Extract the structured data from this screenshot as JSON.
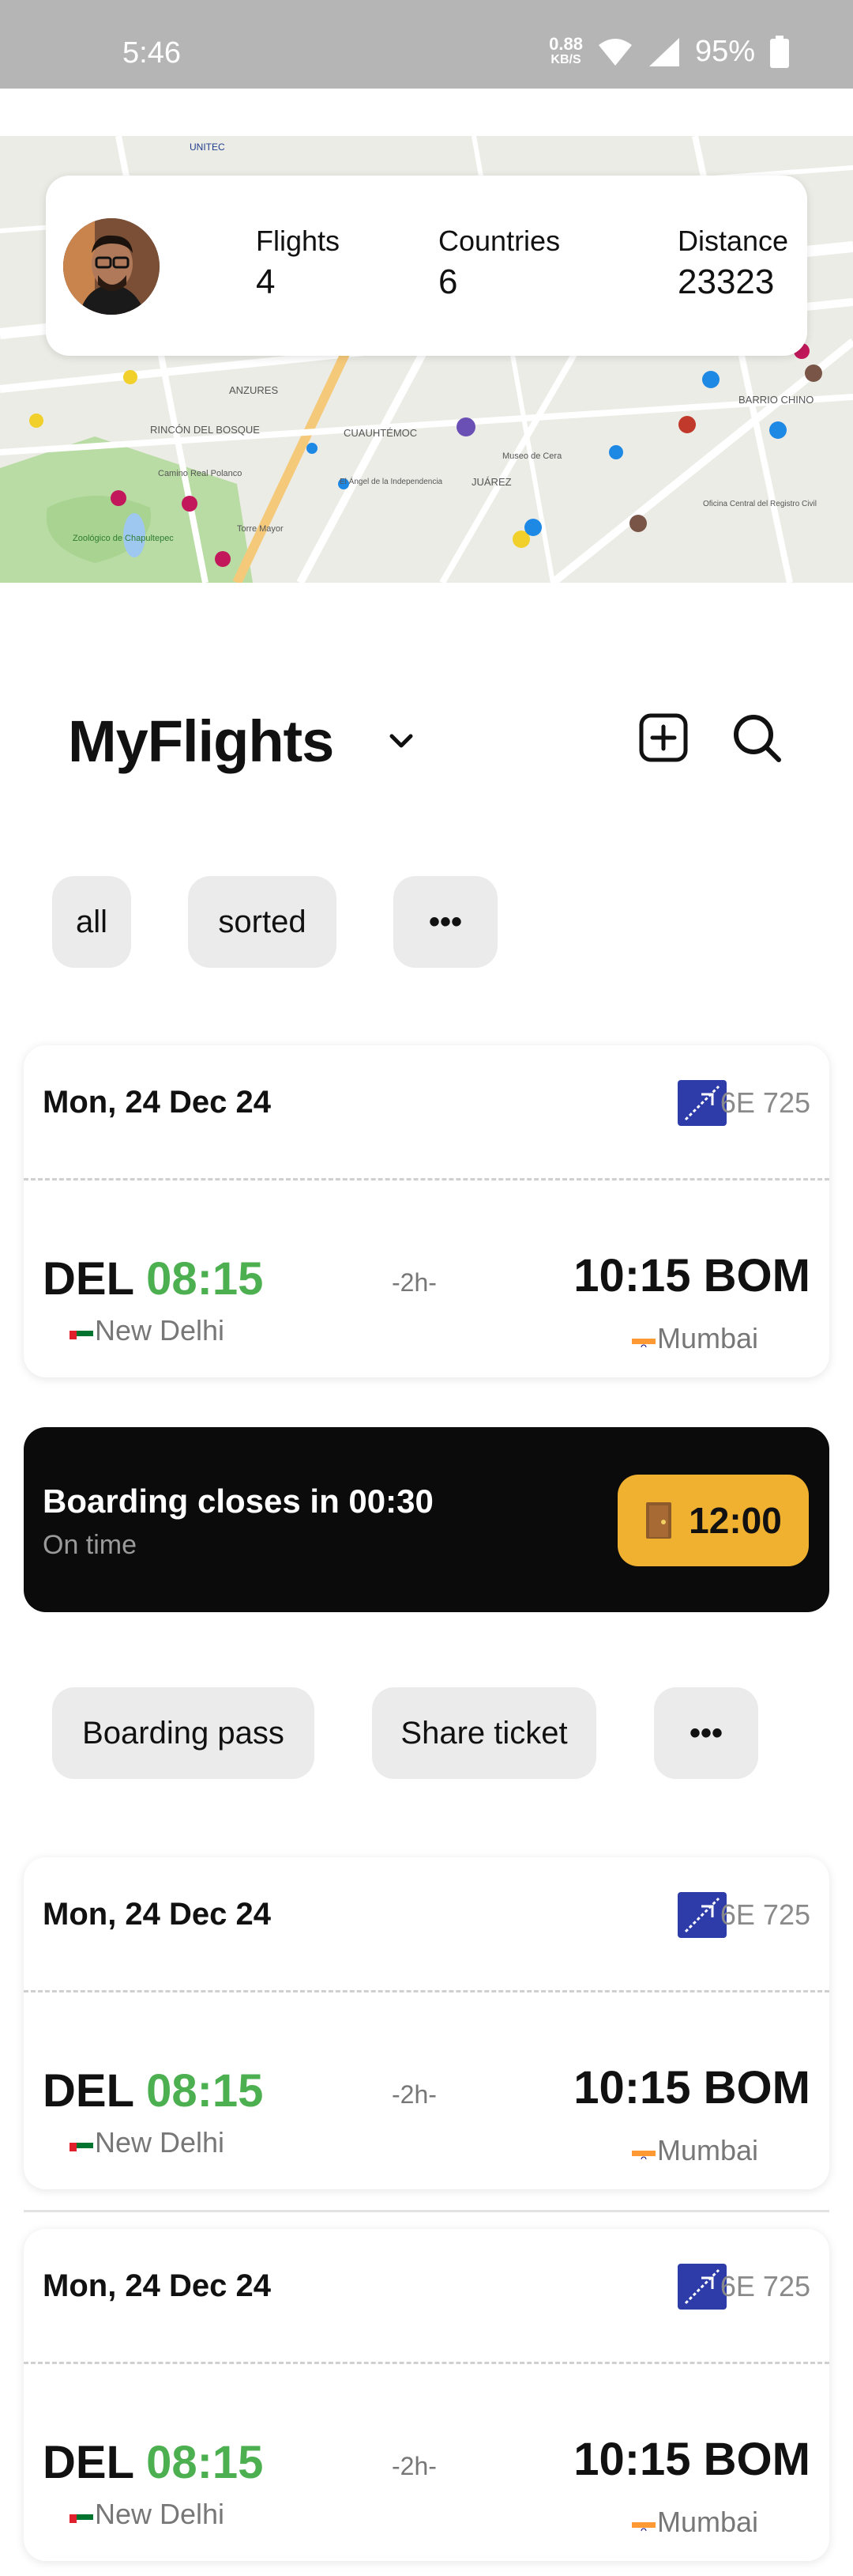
{
  "status_bar": {
    "time": "5:46",
    "net_speed": "0.88",
    "net_unit": "KB/S",
    "battery": "95%"
  },
  "profile": {
    "stats": [
      {
        "label": "Flights",
        "value": "4"
      },
      {
        "label": "Countries",
        "value": "6"
      },
      {
        "label": "Distance",
        "value": "23323"
      }
    ]
  },
  "header": {
    "title": "MyFlights"
  },
  "filters": {
    "all": "all",
    "sorted": "sorted",
    "more": "•••"
  },
  "flights": [
    {
      "date": "Mon, 24 Dec 24",
      "flight_no": "6E 725",
      "dep_code": "DEL",
      "dep_time": "08:15",
      "dep_city": "New Delhi",
      "duration": "-2h-",
      "arr_time": "10:15",
      "arr_code": "BOM",
      "arr_city": "Mumbai"
    },
    {
      "date": "Mon, 24 Dec 24",
      "flight_no": "6E 725",
      "dep_code": "DEL",
      "dep_time": "08:15",
      "dep_city": "New Delhi",
      "duration": "-2h-",
      "arr_time": "10:15",
      "arr_code": "BOM",
      "arr_city": "Mumbai"
    },
    {
      "date": "Mon, 24 Dec 24",
      "flight_no": "6E 725",
      "dep_code": "DEL",
      "dep_time": "08:15",
      "dep_city": "New Delhi",
      "duration": "-2h-",
      "arr_time": "10:15",
      "arr_code": "BOM",
      "arr_city": "Mumbai"
    }
  ],
  "boarding": {
    "message": "Boarding closes in 00:30",
    "status": "On time",
    "gate_time": "12:00"
  },
  "actions": {
    "boarding_pass": "Boarding pass",
    "share_ticket": "Share ticket",
    "more": "•••"
  },
  "map_labels": [
    "ANZURES",
    "RINCÓN DEL BOSQUE",
    "CUAUHTÉMOC",
    "JUÁREZ",
    "BARRIO CHINO",
    "Camino Real Polanco",
    "Zoológico de Chapultepec",
    "El Ángel de la Independencia",
    "Torre Mayor",
    "Museo de Cera",
    "Oficina Central del Registro Civil",
    "UNITEC"
  ],
  "colors": {
    "accent_green": "#4caf50",
    "gate_yellow": "#f0b030",
    "banner_black": "#0b0b0b",
    "airline_blue": "#2d3ca8"
  }
}
